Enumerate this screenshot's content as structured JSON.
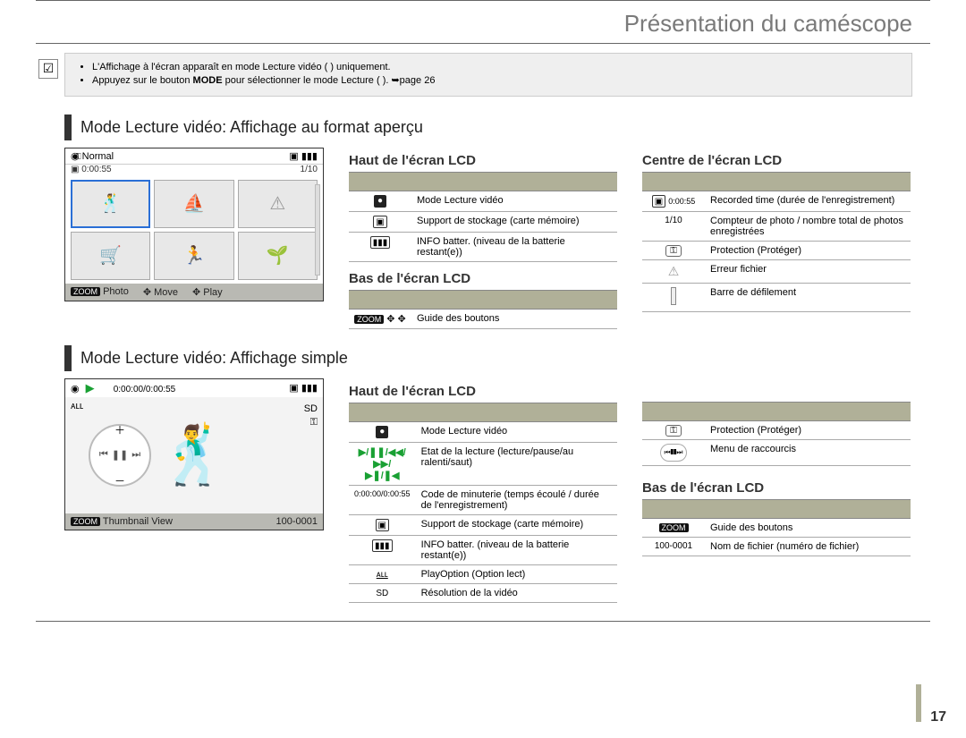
{
  "page_title": "Présentation du caméscope",
  "page_number": "17",
  "note": {
    "bullets": [
      "L'Affichage à l'écran apparaît en mode Lecture vidéo (   ) uniquement.",
      "Appuyez sur le bouton"
    ],
    "mode_label": "MODE",
    "bullet2_tail": "pour sélectionner le mode Lecture (   ).  ➥page 26"
  },
  "section1_title": "Mode Lecture vidéo: Affichage au format aperçu",
  "lcd1": {
    "header_left": "Normal",
    "time": "0:00:55",
    "count": "1/10",
    "footer_photo": "Photo",
    "footer_move": "Move",
    "footer_play": "Play",
    "zoom": "ZOOM"
  },
  "haut1_title": "Haut de l'écran LCD",
  "haut1_rows": [
    {
      "icon": "video-filled",
      "text": "Mode Lecture vidéo"
    },
    {
      "icon": "card-outline",
      "text": "Support de stockage (carte mémoire)"
    },
    {
      "icon": "battery",
      "text": "INFO batter. (niveau de la batterie restant(e))"
    }
  ],
  "bas1_title": "Bas de l'écran LCD",
  "bas1_rows": [
    {
      "icon": "zoom-joy",
      "text": "Guide des boutons"
    }
  ],
  "centre_title": "Centre de l'écran LCD",
  "centre_rows": [
    {
      "icon_text": "0:00:55",
      "text": "Recorded time (durée de l'enregistrement)"
    },
    {
      "icon_text": "1/10",
      "text": "Compteur de photo / nombre total de photos enregistrées"
    },
    {
      "icon": "key",
      "text": "Protection (Protéger)"
    },
    {
      "icon": "warn",
      "text": "Erreur fichier"
    },
    {
      "icon": "scrollbar",
      "text": "Barre de défilement"
    }
  ],
  "section2_title": "Mode Lecture vidéo: Affichage simple",
  "lcd2": {
    "timecode": "0:00:00/0:00:55",
    "right": {
      "sd": "SD",
      "key": "⚿"
    },
    "footer_thumb": "Thumbnail View",
    "file_no": "100-0001",
    "zoom": "ZOOM"
  },
  "haut2_title": "Haut de l'écran LCD",
  "haut2_rows": [
    {
      "icon": "video-filled",
      "text": "Mode Lecture vidéo"
    },
    {
      "icon": "play-states",
      "text": "Etat de la lecture (lecture/pause/au ralenti/saut)"
    },
    {
      "icon_text": "0:00:00/0:00:55",
      "text": "Code de minuterie (temps écoulé / durée de l'enregistrement)"
    },
    {
      "icon": "card-outline",
      "text": "Support de stockage (carte mémoire)"
    },
    {
      "icon": "battery",
      "text": "INFO batter. (niveau de la batterie restant(e))"
    },
    {
      "icon": "all",
      "text": "PlayOption (Option lect)"
    },
    {
      "icon": "sd",
      "text": "Résolution de la vidéo"
    }
  ],
  "right2a_rows": [
    {
      "icon": "key",
      "text": "Protection (Protéger)"
    },
    {
      "icon": "shortcut-ring",
      "text": "Menu de raccourcis"
    }
  ],
  "bas2_title": "Bas de l'écran LCD",
  "bas2_rows": [
    {
      "icon": "zoom-chip",
      "text": "Guide des boutons"
    },
    {
      "icon_text": "100-0001",
      "text": "Nom de fichier (numéro de fichier)"
    }
  ]
}
